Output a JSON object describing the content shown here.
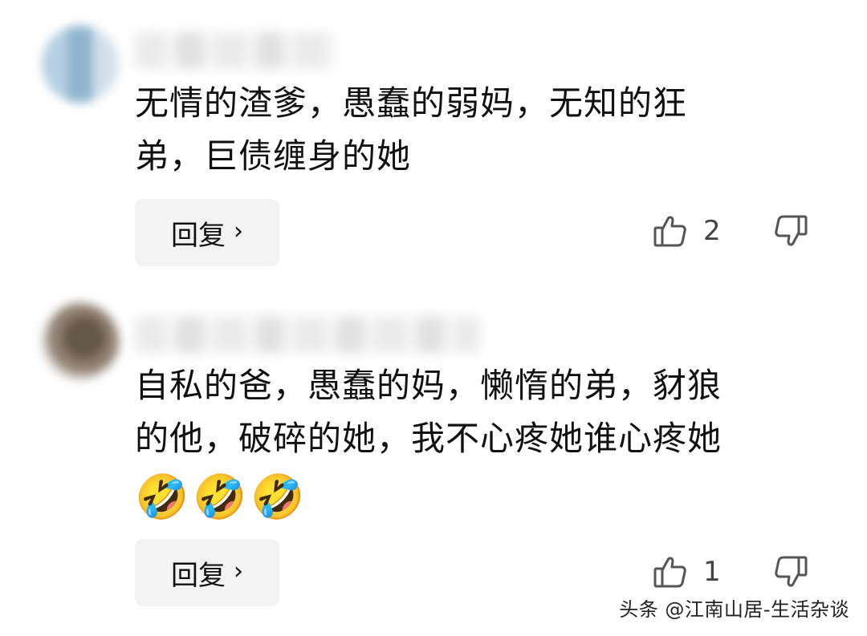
{
  "comments": [
    {
      "text_line1": "无情的渣爹，愚蠢的弱妈，无知的狂",
      "text_line2": "弟，巨债缠身的她",
      "reply_label": "回复",
      "reply_chevron": "›",
      "like_count": "2"
    },
    {
      "text_line1": "自私的爸，愚蠢的妈，懒惰的弟，豺狼",
      "text_line2": "的他，破碎的她，我不心疼她谁心疼她",
      "emojis": [
        "🤣",
        "🤣",
        "🤣"
      ],
      "reply_label": "回复",
      "reply_chevron": "›",
      "like_count": "1"
    }
  ],
  "watermark": "头条 @江南山居-生活杂谈",
  "icons": {
    "like": "thumbs-up-icon",
    "dislike": "thumbs-down-icon",
    "reply_arrow": "chevron-right-icon"
  },
  "colors": {
    "text": "#111111",
    "button_bg": "#f3f3f3",
    "icon": "#555555",
    "count": "#444444"
  }
}
